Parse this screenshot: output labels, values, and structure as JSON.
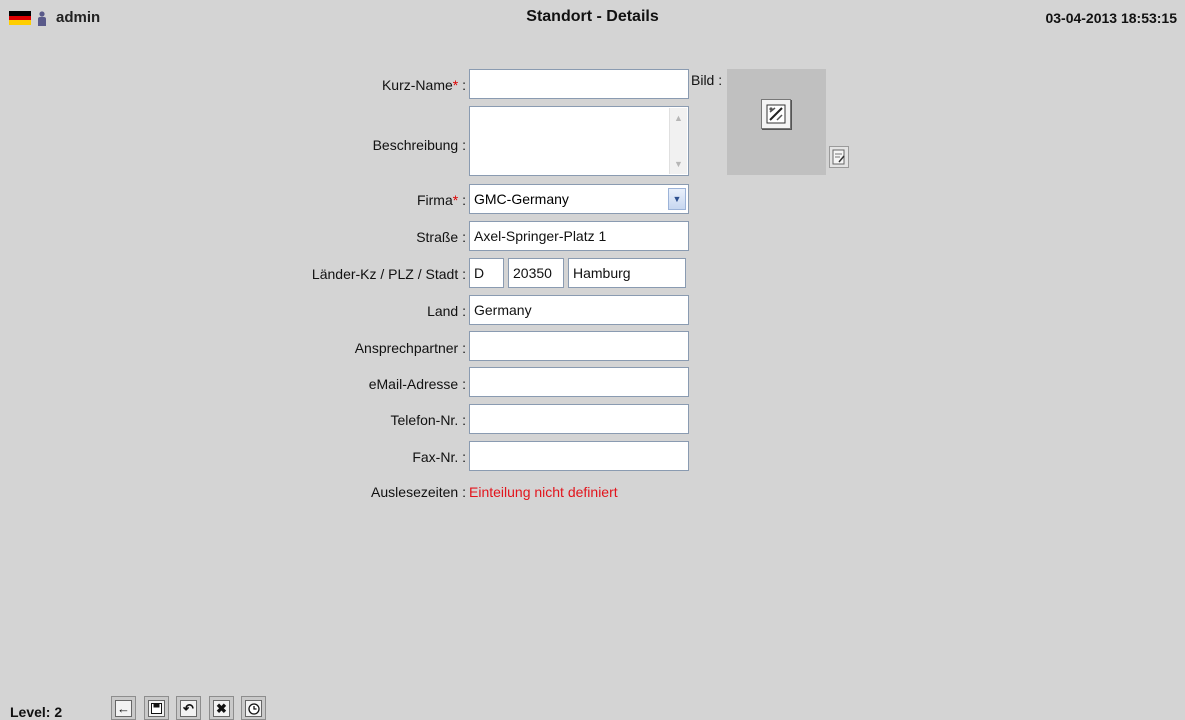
{
  "header": {
    "username": "admin",
    "title": "Standort - Details",
    "datetime": "03-04-2013 18:53:15",
    "flag_colors": [
      "#000000",
      "#dd0000",
      "#ffce00"
    ],
    "user_icon": "user-icon"
  },
  "form": {
    "kurzname": {
      "label": "Kurz-Name",
      "required_mark": "*",
      "sep": " :",
      "value": ""
    },
    "beschreibung": {
      "label": "Beschreibung :",
      "value": ""
    },
    "firma": {
      "label": "Firma",
      "required_mark": "*",
      "sep": " :",
      "value": "GMC-Germany"
    },
    "strasse": {
      "label": "Straße :",
      "value": "Axel-Springer-Platz 1"
    },
    "laender": {
      "label": "Länder-Kz / PLZ / Stadt :",
      "kz": "D",
      "plz": "20350",
      "stadt": "Hamburg"
    },
    "land": {
      "label": "Land :",
      "value": "Germany"
    },
    "ansprechpartner": {
      "label": "Ansprechpartner :",
      "value": ""
    },
    "email": {
      "label": "eMail-Adresse :",
      "value": ""
    },
    "telefon": {
      "label": "Telefon-Nr. :",
      "value": ""
    },
    "fax": {
      "label": "Fax-Nr. :",
      "value": ""
    },
    "auslesezeiten": {
      "label": "Auslesezeiten :",
      "value": "Einteilung nicht definiert",
      "value_color": "#e2141c"
    }
  },
  "bild": {
    "label": "Bild :",
    "placeholder_icon": "picture-placeholder-icon",
    "edit_icon": "edit-image-icon"
  },
  "footer": {
    "level": "Level: 2",
    "buttons": [
      {
        "name": "back-button",
        "icon": "arrow-left-icon",
        "glyph": "←"
      },
      {
        "name": "save-button",
        "icon": "save-icon",
        "glyph": ""
      },
      {
        "name": "undo-button",
        "icon": "undo-icon",
        "glyph": "↶"
      },
      {
        "name": "delete-button",
        "icon": "delete-x-icon",
        "glyph": "✖"
      },
      {
        "name": "history-button",
        "icon": "clock-icon",
        "glyph": ""
      }
    ]
  }
}
